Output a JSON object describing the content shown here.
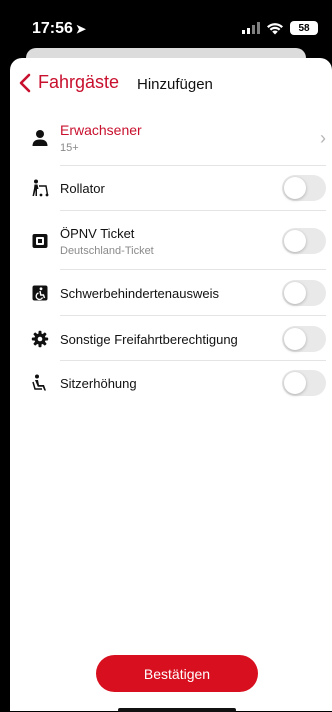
{
  "status": {
    "time": "17:56",
    "battery": "58"
  },
  "nav": {
    "back_label": "Fahrgäste",
    "title": "Hinzufügen"
  },
  "items": [
    {
      "label": "Erwachsener",
      "sub": "15+"
    },
    {
      "label": "Rollator",
      "sub": ""
    },
    {
      "label": "ÖPNV Ticket",
      "sub": "Deutschland-Ticket"
    },
    {
      "label": "Schwerbehindertenausweis",
      "sub": ""
    },
    {
      "label": "Sonstige Freifahrtberechtigung",
      "sub": ""
    },
    {
      "label": "Sitzerhöhung",
      "sub": ""
    }
  ],
  "toggles": {
    "rollator": false,
    "oepnv": false,
    "schwerbehindert": false,
    "sonstige": false,
    "sitzerhoehung": false
  },
  "footer": {
    "confirm_label": "Bestätigen"
  },
  "colors": {
    "accent": "#d80f1e",
    "toggle_off": "#e9e9ea"
  }
}
